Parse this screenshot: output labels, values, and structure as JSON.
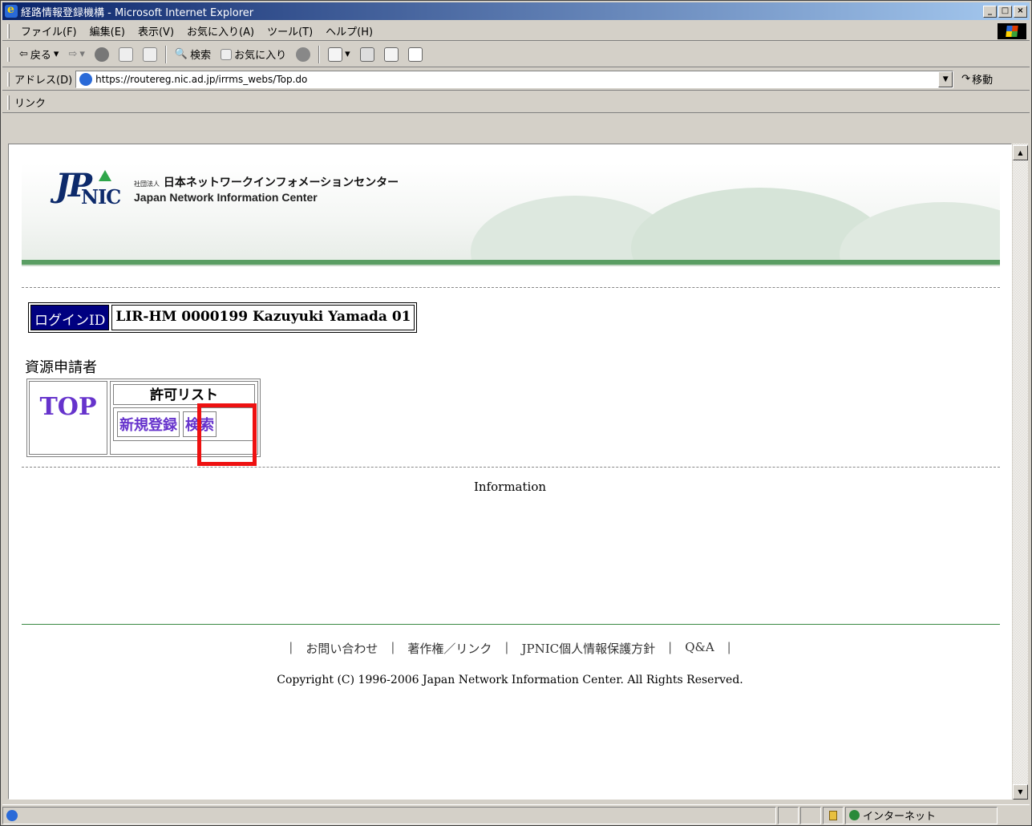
{
  "window": {
    "title": "経路情報登録機構 - Microsoft Internet Explorer",
    "minimize": "_",
    "maximize": "□",
    "close": "×"
  },
  "menu": [
    "ファイル(F)",
    "編集(E)",
    "表示(V)",
    "お気に入り(A)",
    "ツール(T)",
    "ヘルプ(H)"
  ],
  "toolbar": {
    "back": "戻る",
    "search": "検索",
    "favorites": "お気に入り"
  },
  "address": {
    "label": "アドレス(D)",
    "url": "https://routereg.nic.ad.jp/irrms_webs/Top.do",
    "go": "移動"
  },
  "links_label": "リンク",
  "banner": {
    "org_small": "社団法人",
    "org_jp": "日本ネットワークインフォメーションセンター",
    "org_en": "Japan Network Information Center",
    "logo_jp": "JP",
    "logo_nic": "NIC"
  },
  "login": {
    "label": "ログインID",
    "value": "LIR-HM 0000199 Kazuyuki Yamada 01"
  },
  "role": "資源申請者",
  "nav": {
    "top": "TOP",
    "list_title": "許可リスト",
    "new": "新規登録",
    "search": "検索"
  },
  "info": "Information",
  "footer": {
    "links": [
      "お問い合わせ",
      "著作権／リンク",
      "JPNIC個人情報保護方針",
      "Q&A"
    ],
    "copyright": "Copyright (C) 1996-2006 Japan Network Information Center. All Rights Reserved."
  },
  "status": {
    "zone": "インターネット"
  },
  "colors": {
    "nav_link": "#6633cc",
    "login_bg": "#000080",
    "highlight": "#ee1111",
    "banner_line": "#5a9e63"
  }
}
